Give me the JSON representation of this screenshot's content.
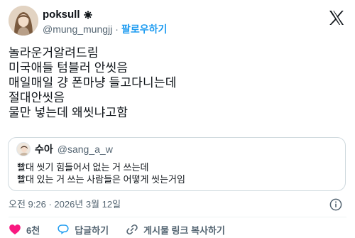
{
  "author": {
    "name": "poksull",
    "handle": "@mung_mungjj",
    "separator": "·",
    "follow_label": "팔로우하기",
    "verified_icon": "badge-icon",
    "logo_icon": "x-logo-icon"
  },
  "tweet": {
    "lines": [
      "놀라운거알려드림",
      "미국애들 텀블러 안씻음",
      "매일매일 걍 폰마냥 들고다니는데",
      "절대안씻음",
      "물만 넣는데 왜씻냐고함"
    ]
  },
  "quoted_tweet": {
    "name": "수아",
    "handle": "@sang_a_w",
    "lines": [
      "빨대 씻기 힘들어서 없는 거 쓰는데",
      "빨대 있는 거 쓰는 사람들은 어떻게 씻는거임"
    ]
  },
  "timestamp": "오전 9:26 · 2026년 3월 12일",
  "actions": {
    "like_count": "6천",
    "reply_label": "답글하기",
    "copy_link_label": "게시물 링크 복사하기"
  },
  "colors": {
    "accent": "#1d9bf0",
    "like": "#f91880",
    "secondary_text": "#536471",
    "border": "#cfd9de"
  }
}
